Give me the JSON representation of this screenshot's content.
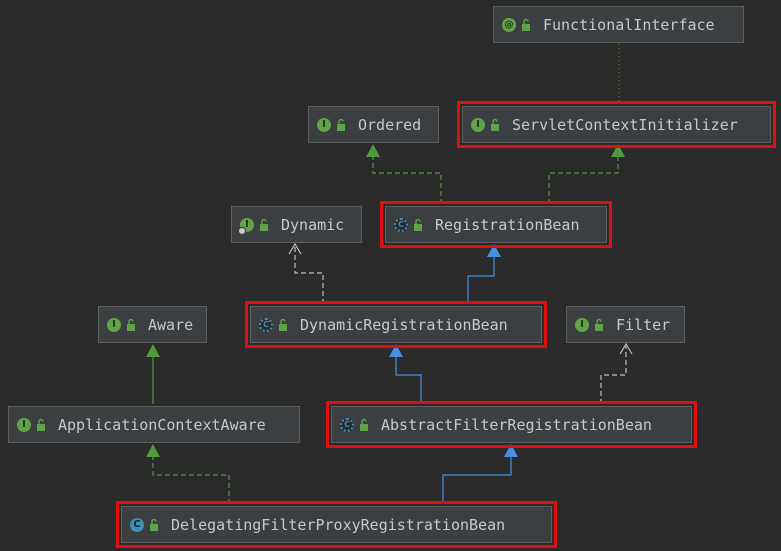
{
  "nodes": {
    "functional_interface": {
      "label": "FunctionalInterface",
      "kind": "annotation",
      "badge": "@"
    },
    "servlet_context_initializer": {
      "label": "ServletContextInitializer",
      "kind": "interface",
      "badge": "I"
    },
    "ordered": {
      "label": "Ordered",
      "kind": "interface",
      "badge": "I"
    },
    "dynamic": {
      "label": "Dynamic",
      "kind": "interface",
      "badge": "I"
    },
    "registration_bean": {
      "label": "RegistrationBean",
      "kind": "abstract-class",
      "badge": "C"
    },
    "aware": {
      "label": "Aware",
      "kind": "interface",
      "badge": "I"
    },
    "dynamic_registration_bean": {
      "label": "DynamicRegistrationBean",
      "kind": "abstract-class",
      "badge": "C"
    },
    "filter": {
      "label": "Filter",
      "kind": "interface",
      "badge": "I"
    },
    "application_context_aware": {
      "label": "ApplicationContextAware",
      "kind": "interface",
      "badge": "I"
    },
    "abstract_filter_registration_bean": {
      "label": "AbstractFilterRegistrationBean",
      "kind": "abstract-class",
      "badge": "C"
    },
    "delegating_filter_proxy_registration_bean": {
      "label": "DelegatingFilterProxyRegistrationBean",
      "kind": "class",
      "badge": "C"
    }
  },
  "colors": {
    "background": "#2b2b2b",
    "node_fill": "#3c3f41",
    "node_border": "#5e6060",
    "text": "#c8c8c8",
    "highlight": "#e01010",
    "implements_edge": "#4f9a3a",
    "extends_edge": "#4a90e2",
    "dependency_edge": "#c0c0c0"
  }
}
